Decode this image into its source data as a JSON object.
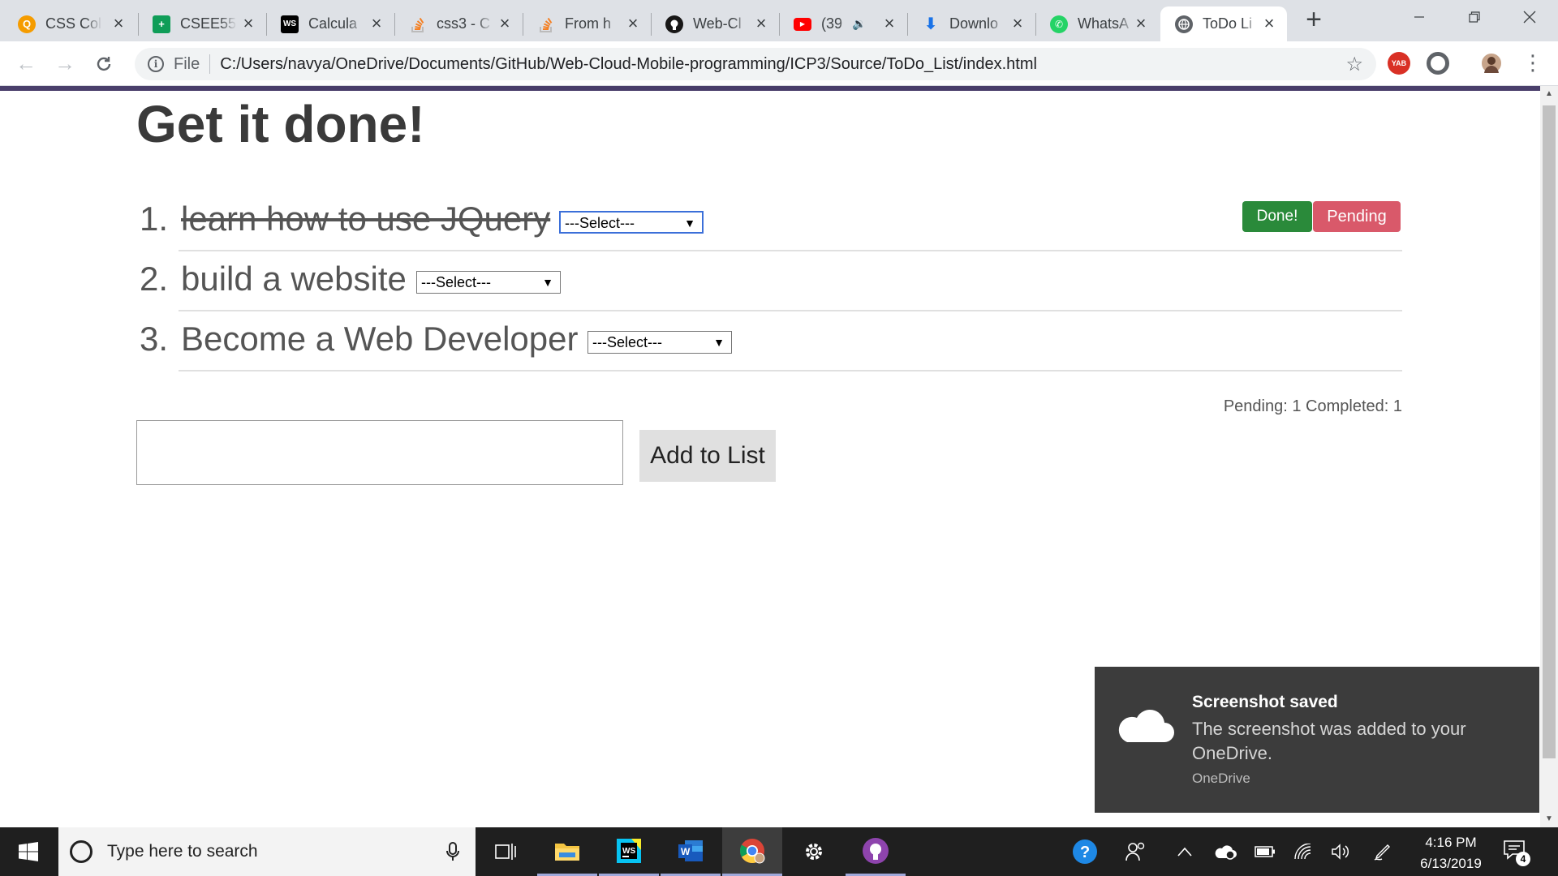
{
  "browser": {
    "tabs": [
      {
        "title": "CSS Col",
        "icon": "css-colors-site-icon",
        "color": "#f59c00"
      },
      {
        "title": "CSEE55",
        "icon": "google-sheets-icon",
        "color": "#0f9d58"
      },
      {
        "title": "Calcula",
        "icon": "webstorm-icon",
        "color": "#000000"
      },
      {
        "title": "css3 - C",
        "icon": "stackoverflow-icon",
        "color": "#f48024"
      },
      {
        "title": "From h",
        "icon": "stackoverflow-icon",
        "color": "#f48024"
      },
      {
        "title": "Web-Cl",
        "icon": "github-icon",
        "color": "#181717"
      },
      {
        "title": "(39",
        "icon": "youtube-icon",
        "color": "#ff0000"
      },
      {
        "title": "Downlo",
        "icon": "download-icon",
        "color": "#1a73e8"
      },
      {
        "title": "WhatsA",
        "icon": "whatsapp-icon",
        "color": "#25d366"
      },
      {
        "title": "ToDo Li",
        "icon": "globe-icon",
        "color": "#5f6368",
        "active": true
      }
    ],
    "address": {
      "scheme": "File",
      "url": "C:/Users/navya/OneDrive/Documents/GitHub/Web-Cloud-Mobile-programming/ICP3/Source/ToDo_List/index.html"
    },
    "extensions": [
      {
        "icon": "yab-extension-icon",
        "label": "YAB",
        "color": "#d93025"
      },
      {
        "icon": "extension-circle-icon",
        "color": "#5f6368"
      }
    ]
  },
  "page": {
    "heading": "Get it done!",
    "todos": [
      {
        "number": "1.",
        "text": "learn how to use JQuery",
        "done": true,
        "select": "---Select---",
        "focused": true
      },
      {
        "number": "2.",
        "text": "build a website",
        "done": false,
        "select": "---Select---",
        "focused": false
      },
      {
        "number": "3.",
        "text": "Become a Web Developer",
        "done": false,
        "select": "---Select---",
        "focused": false
      }
    ],
    "buttons": {
      "done": "Done!",
      "pending": "Pending"
    },
    "counts": "Pending: 1 Completed: 1",
    "input": {
      "value": "",
      "placeholder": ""
    },
    "add_button": "Add to List"
  },
  "toast": {
    "title": "Screenshot saved",
    "body": "The screenshot was added to your OneDrive.",
    "source": "OneDrive"
  },
  "taskbar": {
    "search_placeholder": "Type here to search",
    "apps": [
      {
        "icon": "task-view-icon"
      },
      {
        "icon": "file-explorer-icon"
      },
      {
        "icon": "webstorm-icon"
      },
      {
        "icon": "word-icon"
      },
      {
        "icon": "chrome-icon"
      },
      {
        "icon": "settings-icon"
      },
      {
        "icon": "github-desktop-icon"
      }
    ],
    "tray": {
      "time": "4:16 PM",
      "date": "6/13/2019",
      "notifications": "4"
    }
  },
  "colors": {
    "accent_bar": "#4a3f6b",
    "done_button": "#2a8a3a",
    "pending_button": "#d9596a",
    "toast_bg": "#3c3c3c",
    "taskbar_bg": "#1f1f1f"
  }
}
